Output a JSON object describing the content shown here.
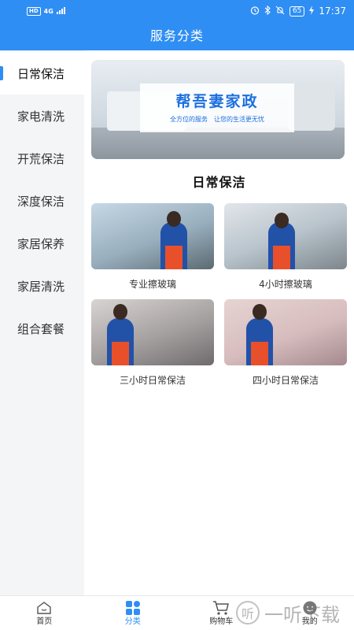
{
  "status_bar": {
    "network": "HD",
    "signal": "4G",
    "battery": "65",
    "time": "17:37"
  },
  "header": {
    "title": "服务分类"
  },
  "sidebar": {
    "items": [
      {
        "label": "日常保洁",
        "active": true
      },
      {
        "label": "家电清洗",
        "active": false
      },
      {
        "label": "开荒保洁",
        "active": false
      },
      {
        "label": "深度保洁",
        "active": false
      },
      {
        "label": "家居保养",
        "active": false
      },
      {
        "label": "家居清洗",
        "active": false
      },
      {
        "label": "组合套餐",
        "active": false
      }
    ]
  },
  "banner": {
    "brand": "帮吾妻家政",
    "slogan": "全方位的服务　让您的生活更无忧"
  },
  "main": {
    "section_title": "日常保洁",
    "services": [
      {
        "label": "专业擦玻璃",
        "icon": "window-cleaning-photo"
      },
      {
        "label": "4小时擦玻璃",
        "icon": "window-cleaning-photo"
      },
      {
        "label": "三小时日常保洁",
        "icon": "table-cleaning-photo"
      },
      {
        "label": "四小时日常保洁",
        "icon": "sofa-cleaning-photo"
      }
    ]
  },
  "tabbar": {
    "tabs": [
      {
        "label": "首页",
        "icon": "home-icon",
        "active": false
      },
      {
        "label": "分类",
        "icon": "grid-icon",
        "active": true
      },
      {
        "label": "购物车",
        "icon": "cart-icon",
        "active": false
      },
      {
        "label": "我的",
        "icon": "user-icon",
        "active": false
      }
    ]
  },
  "watermark": {
    "text": "一听下载",
    "glyph": "听"
  },
  "colors": {
    "primary": "#2f8ef3",
    "apron": "#e8502b",
    "uniform": "#2251a8"
  }
}
